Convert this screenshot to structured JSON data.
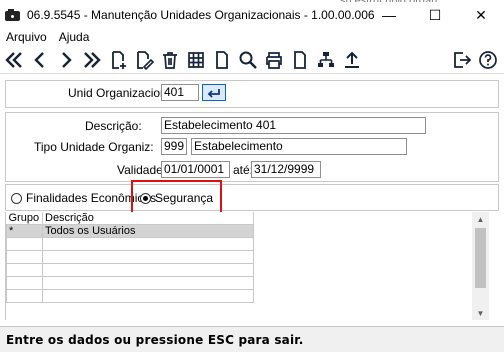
{
  "window": {
    "title": "06.9.5545 - Manutenção Unidades Organizacionais - 1.00.00.006",
    "bg_fragment": "su  estrut  unid  organ",
    "minimize": "—",
    "maximize": "☐",
    "close": "✕"
  },
  "menu": [
    "Arquivo",
    "Ajuda"
  ],
  "toolbar": {
    "buttons": [
      "first-icon",
      "prev-icon",
      "next-icon",
      "last-icon",
      "new-icon",
      "edit-icon",
      "delete-icon",
      "grid-icon",
      "document-icon",
      "search-icon",
      "print-icon",
      "blank-page-icon",
      "tree-icon",
      "upload-icon"
    ],
    "right_buttons": [
      "exit-icon",
      "help-icon"
    ],
    "icon_color": "#17233a"
  },
  "form": {
    "unid_label": "Unid Organizacional:",
    "unid_value": "401",
    "descricao_label": "Descrição:",
    "descricao_value": "Estabelecimento 401",
    "tipo_label": "Tipo Unidade Organiz:",
    "tipo_code": "999",
    "tipo_desc": "Estabelecimento",
    "validade_label": "Validade:",
    "validade_inicio": "01/01/0001",
    "validade_ate_label": "até:",
    "validade_fim": "31/12/9999"
  },
  "radios": {
    "finalidades_label": "Finalidades Econômicas",
    "seguranca_label": "Segurança",
    "selected": "Segurança"
  },
  "grid": {
    "headers": [
      "Grupo",
      "Descrição"
    ],
    "rows": [
      [
        "*",
        "Todos os Usuários"
      ],
      [
        "",
        ""
      ],
      [
        "",
        ""
      ],
      [
        "",
        ""
      ],
      [
        "",
        ""
      ],
      [
        "",
        ""
      ]
    ]
  },
  "status": "Entre os dados ou pressione ESC para sair.",
  "colors": {
    "highlight_box": "#e01010",
    "selected_row": "#d4d4d4",
    "enter_button_border": "#0a64c8"
  }
}
